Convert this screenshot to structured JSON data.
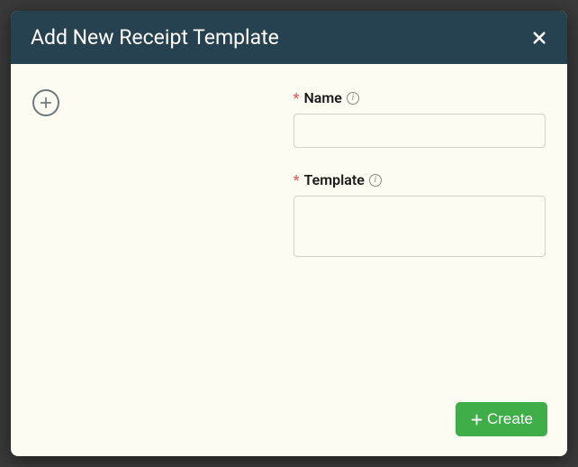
{
  "header": {
    "title": "Add New Receipt Template"
  },
  "form": {
    "name": {
      "label": "Name",
      "required_marker": "*",
      "value": "",
      "placeholder": ""
    },
    "template": {
      "label": "Template",
      "required_marker": "*",
      "value": "",
      "placeholder": ""
    }
  },
  "footer": {
    "create_label": "Create"
  }
}
